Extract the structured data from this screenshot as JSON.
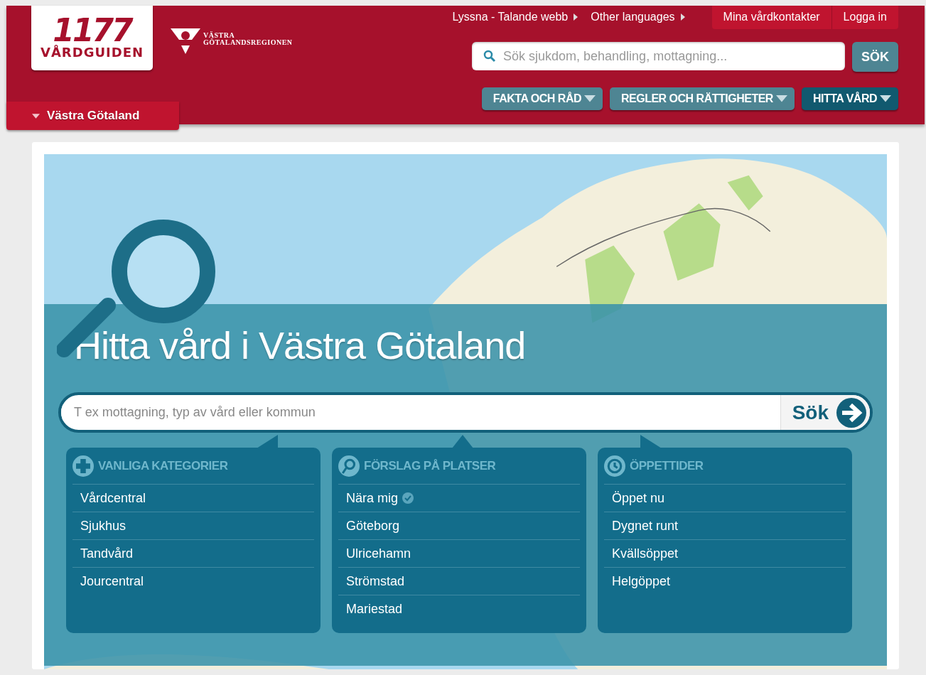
{
  "header": {
    "logo": {
      "number": "1177",
      "name": "VÅRDGUIDEN"
    },
    "region_logo": {
      "line_1": "VÄSTRA",
      "line_2": "GÖTALANDSREGIONEN"
    },
    "top_links": [
      {
        "label": "Lyssna - Talande webb"
      },
      {
        "label": "Other languages"
      }
    ],
    "account_links": [
      {
        "label": "Mina vårdkontakter"
      },
      {
        "label": "Logga in"
      }
    ],
    "search": {
      "placeholder": "Sök sjukdom, behandling, mottagning...",
      "button": "SÖK"
    },
    "nav": [
      {
        "label": "FAKTA OCH RÅD",
        "selected": false
      },
      {
        "label": "REGLER OCH RÄTTIGHETER",
        "selected": false
      },
      {
        "label": "HITTA VÅRD",
        "selected": true
      }
    ],
    "region_selector": {
      "label": "Västra Götaland",
      "expanded": false
    }
  },
  "hero": {
    "title": "Hitta vård i Västra Götaland",
    "search": {
      "placeholder": "T ex mottagning, typ av vård eller kommun",
      "button": "Sök"
    },
    "panels": [
      {
        "kind": "categories",
        "heading": "VANLIGA KATEGORIER",
        "items": [
          {
            "label": "Vårdcentral",
            "kind": "link"
          },
          {
            "label": "Sjukhus",
            "kind": "link"
          },
          {
            "label": "Tandvård",
            "kind": "link"
          },
          {
            "label": "Jourcentral",
            "kind": "link"
          }
        ]
      },
      {
        "kind": "places",
        "heading": "FÖRSLAG PÅ PLATSER",
        "items": [
          {
            "label": "Nära mig",
            "kind": "location"
          },
          {
            "label": "Göteborg",
            "kind": "link"
          },
          {
            "label": "Ulricehamn",
            "kind": "link"
          },
          {
            "label": "Strömstad",
            "kind": "link"
          },
          {
            "label": "Mariestad",
            "kind": "link"
          }
        ]
      },
      {
        "kind": "hours",
        "heading": "ÖPPETTIDER",
        "items": [
          {
            "label": "Öppet nu",
            "kind": "link"
          },
          {
            "label": "Dygnet runt",
            "kind": "link"
          },
          {
            "label": "Kvällsöppet",
            "kind": "link"
          },
          {
            "label": "Helgöppet",
            "kind": "link"
          }
        ]
      }
    ]
  }
}
